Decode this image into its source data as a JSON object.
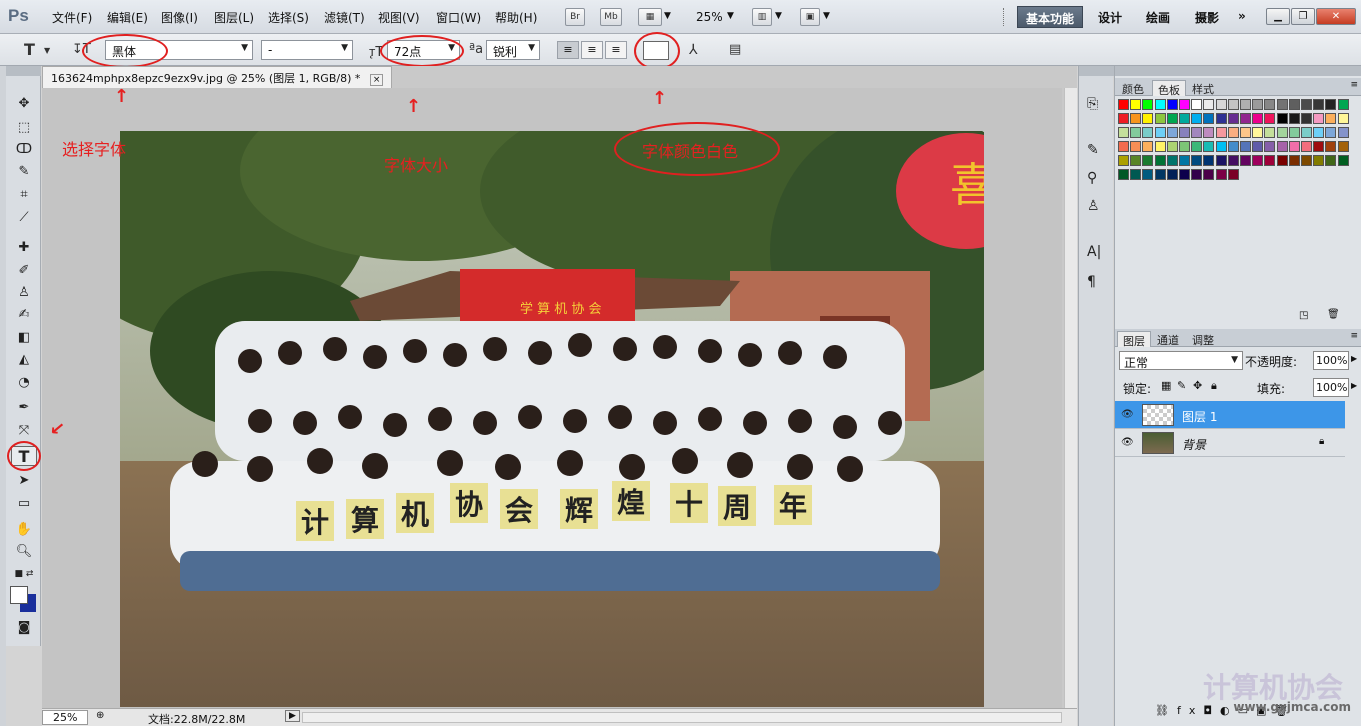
{
  "menu": {
    "items": [
      "文件(F)",
      "编辑(E)",
      "图像(I)",
      "图层(L)",
      "选择(S)",
      "滤镜(T)",
      "视图(V)",
      "窗口(W)",
      "帮助(H)"
    ],
    "br": "Br",
    "mb": "Mb",
    "zoom": "25%",
    "workspaces": [
      "基本功能",
      "设计",
      "绘画",
      "摄影"
    ],
    "more": "»"
  },
  "options": {
    "font_family": "黑体",
    "font_style": "-",
    "font_size": "72点",
    "antialias": "锐利"
  },
  "annotations": {
    "select_font": "选择字体",
    "font_size": "字体大小",
    "font_color": "字体颜色白色"
  },
  "document": {
    "tab_title": "163624mphpx8epzc9ezx9v.jpg @ 25% (图层 1, RGB/8) *",
    "tab_close": "×",
    "banner_text": "学 算 机 协 会",
    "sign_chars": [
      "计",
      "算",
      "机",
      "协",
      "会",
      "辉",
      "煌",
      "十",
      "周",
      "年"
    ],
    "lantern_char": "喜"
  },
  "status": {
    "zoom": "25%",
    "doc_info": "文档:22.8M/22.8M"
  },
  "panels": {
    "color_tabs": [
      "颜色",
      "色板",
      "样式"
    ],
    "layer_tabs": [
      "图层",
      "通道",
      "调整"
    ],
    "blend_mode": "正常",
    "opacity_label": "不透明度:",
    "opacity_value": "100%",
    "lock_label": "锁定:",
    "fill_label": "填充:",
    "fill_value": "100%",
    "layers": [
      {
        "name": "图层 1",
        "selected": true
      },
      {
        "name": "背景",
        "selected": false,
        "locked": true
      }
    ]
  },
  "watermark": {
    "text": "计算机协会",
    "url": "www.gxjmca.com"
  },
  "colors": {
    "accent_selection": "#3d96e8",
    "annotation_red": "#e62020"
  }
}
